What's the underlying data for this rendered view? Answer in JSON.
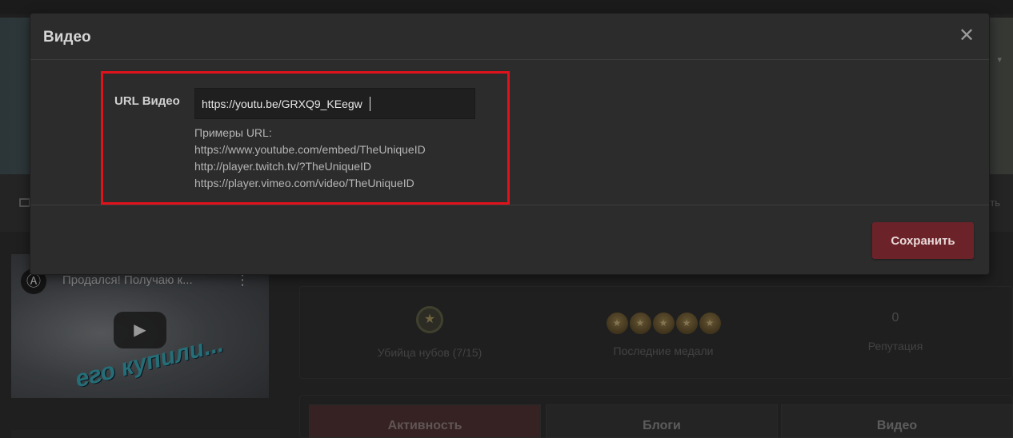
{
  "modal": {
    "title": "Видео",
    "close_glyph": "✕",
    "field_label": "URL Видео",
    "url_value": "https://youtu.be/GRXQ9_KEegw",
    "help_title": "Примеры URL:",
    "help_examples": [
      "https://www.youtube.com/embed/TheUniqueID",
      "http://player.twitch.tv/?TheUniqueID",
      "https://player.vimeo.com/video/TheUniqueID"
    ],
    "save_label": "Сохранить"
  },
  "background": {
    "cover_right_text": "ть",
    "video_card": {
      "title": "Продался! Получаю к...",
      "caption": "его купили..."
    },
    "stats": [
      {
        "label": "Убийца нубов (7/15)",
        "icon": "star-badge-icon"
      },
      {
        "label": "Последние медали",
        "icon": "medal-icon",
        "medal_count": 5
      },
      {
        "label": "Репутация",
        "value": "0"
      }
    ],
    "tabs": [
      {
        "label": "Активность",
        "active": true
      },
      {
        "label": "Блоги",
        "active": false
      },
      {
        "label": "Видео",
        "active": false
      }
    ]
  },
  "colors": {
    "modal_bg": "#2c2c2c",
    "save_button": "#6b2329",
    "highlight": "#e0121b"
  }
}
